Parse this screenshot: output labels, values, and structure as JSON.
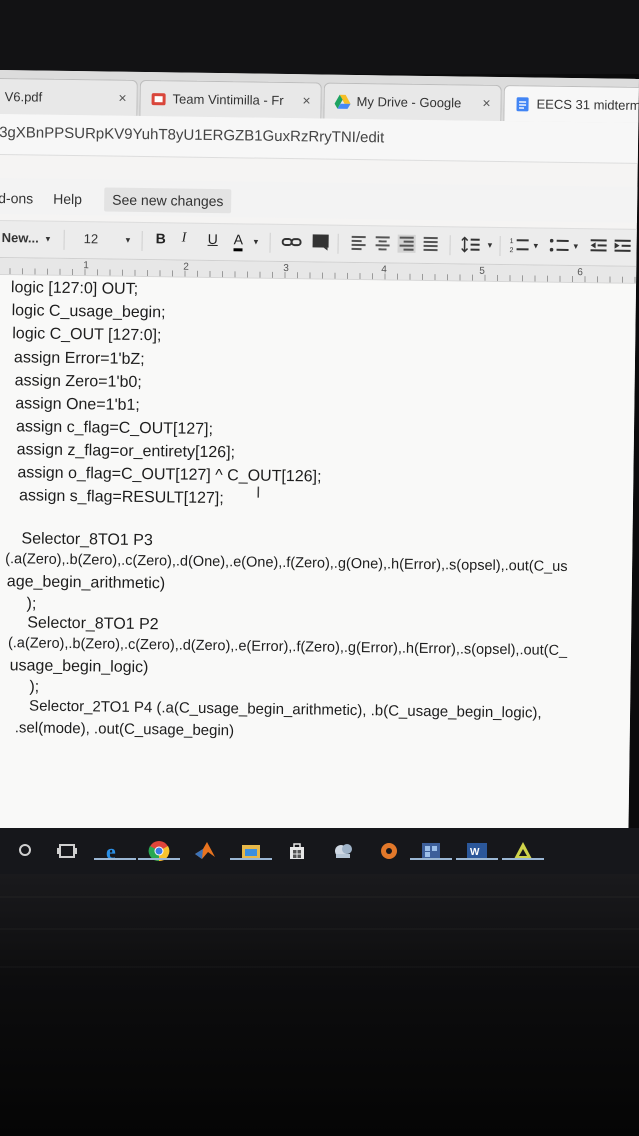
{
  "browser": {
    "tabs": [
      {
        "title": "V6.pdf",
        "close": "×"
      },
      {
        "title": "Team Vintimilla - Fr",
        "close": "×"
      },
      {
        "title": "My Drive - Google",
        "close": "×"
      },
      {
        "title": "EECS 31 midterm",
        "close": ""
      }
    ],
    "url": "3gXBnPPSURpKV9YuhT8yU1ERGZB1GuxRzRryTNI/edit"
  },
  "menu": {
    "items": [
      "d-ons",
      "Help"
    ],
    "see_new_changes": "See new changes"
  },
  "toolbar": {
    "font_family": "New...",
    "font_size": "12",
    "bold": "B",
    "italic": "I",
    "underline": "U",
    "text_color": "A",
    "dropdown_caret": "▾"
  },
  "ruler": {
    "numbers": [
      "1",
      "2",
      "3",
      "4",
      "5",
      "6"
    ]
  },
  "document": {
    "lines": [
      "logic [127:0] OUT;",
      "logic C_usage_begin;",
      "logic C_OUT [127:0];",
      "assign Error=1'bZ;",
      "assign Zero=1'b0;",
      "assign One=1'b1;",
      "assign c_flag=C_OUT[127];",
      "assign z_flag=or_entirety[126];",
      "assign o_flag=C_OUT[127] ^ C_OUT[126];",
      "assign s_flag=RESULT[127];",
      "Selector_8TO1 P3",
      "(.a(Zero),.b(Zero),.c(Zero),.d(One),.e(One),.f(Zero),.g(One),.h(Error),.s(opsel),.out(C_us",
      "age_begin_arithmetic)",
      ");",
      "Selector_8TO1 P2",
      "(.a(Zero),.b(Zero),.c(Zero),.d(Zero),.e(Error),.f(Zero),.g(Error),.h(Error),.s(opsel),.out(C_",
      "usage_begin_logic)",
      ");",
      "Selector_2TO1 P4 (.a(C_usage_begin_arithmetic), .b(C_usage_begin_logic),",
      ".sel(mode), .out(C_usage_begin)"
    ]
  },
  "colors": {
    "chrome_bg": "#dcdcdc",
    "docs_blue": "#4285f4",
    "taskbar_bg": "#16171b"
  },
  "taskbar": {
    "icons": [
      "search-icon",
      "task-view-icon",
      "edge-icon",
      "chrome-icon",
      "matlab-icon",
      "file-explorer-icon",
      "store-icon",
      "app-icon",
      "settings-icon",
      "virtualbox-icon",
      "word-icon",
      "quartus-icon"
    ]
  }
}
